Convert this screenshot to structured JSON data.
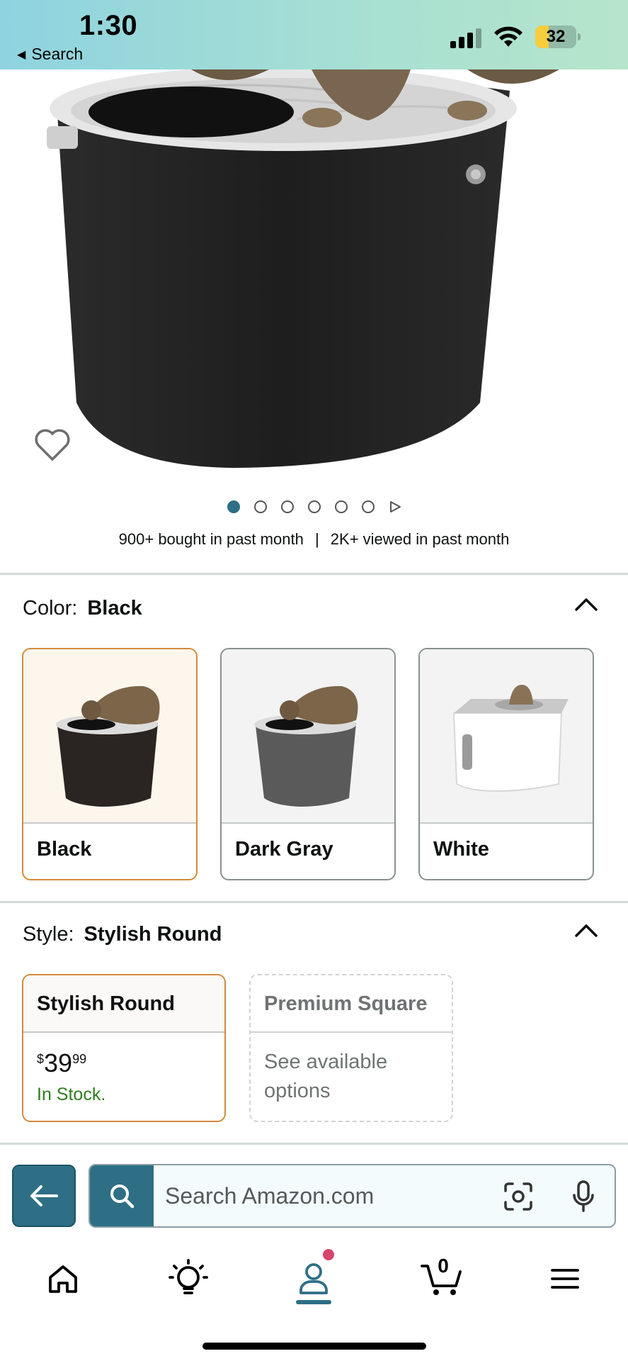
{
  "status_bar": {
    "time": "1:30",
    "back_app_label": "Search",
    "battery_level": "32",
    "battery_fraction": 0.32,
    "battery_color": "#f6cd3c"
  },
  "product": {
    "image_alt": "Black round top-entry cat litter box with cat",
    "carousel": {
      "total_images": 6,
      "active_index": 0
    },
    "social_proof": {
      "bought": "900+ bought in past month",
      "separator": "|",
      "viewed": "2K+ viewed in past month"
    }
  },
  "color_section": {
    "label": "Color:",
    "selected_value": "Black",
    "options": [
      {
        "label": "Black",
        "selected": true
      },
      {
        "label": "Dark Gray",
        "selected": false
      },
      {
        "label": "White",
        "selected": false
      }
    ]
  },
  "style_section": {
    "label": "Style:",
    "selected_value": "Stylish Round",
    "options": [
      {
        "label": "Stylish Round",
        "price_symbol": "$",
        "price_whole": "39",
        "price_fraction": "99",
        "stock": "In Stock.",
        "selected": true
      },
      {
        "label": "Premium Square",
        "note": "See available options",
        "selected": false
      }
    ]
  },
  "search": {
    "placeholder": "Search Amazon.com"
  },
  "bottom_nav": {
    "items": [
      "home-icon",
      "lightbulb-icon",
      "account-icon",
      "cart-icon",
      "menu-icon"
    ],
    "cart_count": "0",
    "active": "account-icon"
  },
  "colors": {
    "accent": "#2e6f85",
    "selected_border": "#d48a3a",
    "in_stock": "#2f7d1e",
    "notification": "#d6456b"
  }
}
